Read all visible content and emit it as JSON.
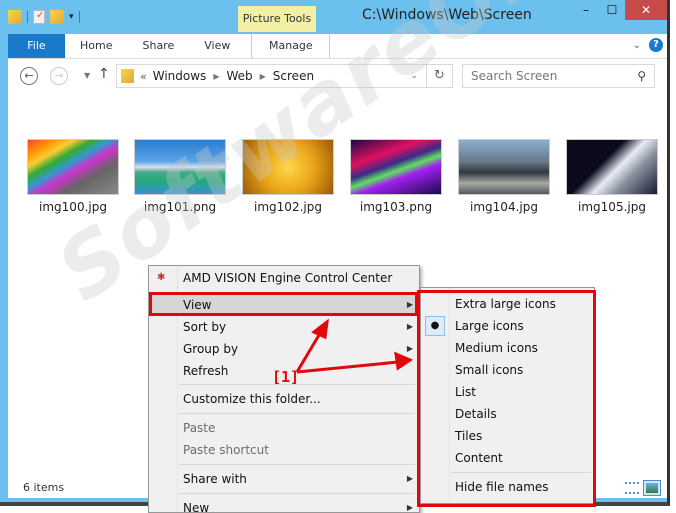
{
  "window": {
    "title": "C:\\Windows\\Web\\Screen",
    "contextual_tab_group": "Picture Tools",
    "controls": {
      "minimize": "–",
      "maximize": "☐",
      "close": "✕"
    }
  },
  "quick_access": {
    "dropdown_glyph": "▾"
  },
  "ribbon": {
    "tabs": [
      {
        "label": "File"
      },
      {
        "label": "Home"
      },
      {
        "label": "Share"
      },
      {
        "label": "View"
      },
      {
        "label": "Manage"
      }
    ],
    "expand_glyph": "⌄",
    "help_glyph": "?"
  },
  "navigation": {
    "back_glyph": "←",
    "forward_glyph": "→",
    "recent_glyph": "▼",
    "up_glyph": "↑",
    "overflow_glyph": "«",
    "breadcrumb": [
      "Windows",
      "Web",
      "Screen"
    ],
    "breadcrumb_sep": "▶",
    "dropdown_glyph": "⌄",
    "refresh_glyph": "↻"
  },
  "search": {
    "placeholder": "Search Screen",
    "icon_glyph": "⚲"
  },
  "files": [
    {
      "name": "img100.jpg",
      "thumb": "linear-gradient(150deg,#e43 0%,#f90 15%,#fc3 25%,#3a3 35%,#39c 45%,#c3c 55%,#666 70%,#888 100%)"
    },
    {
      "name": "img101.png",
      "thumb": "linear-gradient(180deg,#2b7cd0 0%,#5aa6e8 40%,#dde 50%,#4a8 60%,#2a7 75%,#3b8fd8 100%)"
    },
    {
      "name": "img102.jpg",
      "thumb": "radial-gradient(circle at 50% 50%,#ffd84a 0%,#e8a318 50%,#9a5a08 100%)"
    },
    {
      "name": "img103.png",
      "thumb": "linear-gradient(160deg,#1a0a4a 0%,#e01060 30%,#3a2a8a 45%,#60e060 55%,#a020f0 65%,#1a0a4a 100%)"
    },
    {
      "name": "img104.jpg",
      "thumb": "linear-gradient(180deg,#8ab0d0 0%,#6a7888 40%,#303840 60%,#a8a8a0 80%,#505860 100%)"
    },
    {
      "name": "img105.jpg",
      "thumb": "linear-gradient(135deg,#0a0a1a 0%,#0a0a1a 40%,#e8ecf4 55%,#8890a0 70%,#1a1a30 100%)"
    }
  ],
  "status": {
    "item_count": "6 items"
  },
  "context_menu": {
    "items": [
      {
        "label": "AMD VISION Engine Control Center",
        "icon": "amd-icon",
        "submenu": false,
        "disabled": false
      },
      {
        "label": "View",
        "submenu": true,
        "disabled": false,
        "highlighted": true
      },
      {
        "label": "Sort by",
        "submenu": true,
        "disabled": false
      },
      {
        "label": "Group by",
        "submenu": true,
        "disabled": false
      },
      {
        "label": "Refresh",
        "submenu": false,
        "disabled": false
      },
      {
        "label": "Customize this folder...",
        "submenu": false,
        "disabled": false
      },
      {
        "label": "Paste",
        "submenu": false,
        "disabled": true
      },
      {
        "label": "Paste shortcut",
        "submenu": false,
        "disabled": true
      },
      {
        "label": "Share with",
        "submenu": true,
        "disabled": false
      },
      {
        "label": "New",
        "submenu": true,
        "disabled": false
      }
    ],
    "submenu_arrow": "▶"
  },
  "view_submenu": {
    "items": [
      {
        "label": "Extra large icons",
        "selected": false
      },
      {
        "label": "Large icons",
        "selected": true
      },
      {
        "label": "Medium icons",
        "selected": false
      },
      {
        "label": "Small icons",
        "selected": false
      },
      {
        "label": "List",
        "selected": false
      },
      {
        "label": "Details",
        "selected": false
      },
      {
        "label": "Tiles",
        "selected": false
      },
      {
        "label": "Content",
        "selected": false
      },
      {
        "label": "Hide file names",
        "selected": false
      }
    ],
    "selected_glyph": "●"
  },
  "annotation": {
    "label": "[1]",
    "color": "#e3070b"
  },
  "watermark": "SoftwareOK.com"
}
